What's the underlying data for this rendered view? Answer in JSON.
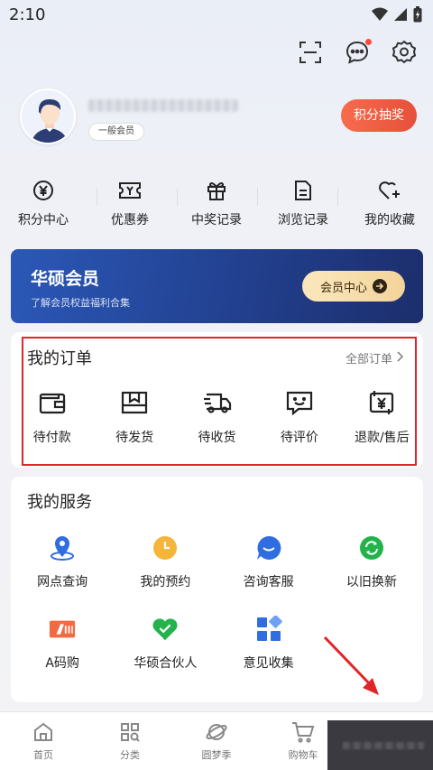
{
  "status_bar": {
    "time": "2:10"
  },
  "top_bar": {
    "icons": [
      "scan-icon",
      "message-icon",
      "settings-icon"
    ],
    "has_notification": true
  },
  "profile": {
    "member_level": "一般会员",
    "points_draw_label": "积分抽奖"
  },
  "quick_links": [
    {
      "label": "积分中心",
      "icon": "yen-coin-icon"
    },
    {
      "label": "优惠券",
      "icon": "coupon-icon"
    },
    {
      "label": "中奖记录",
      "icon": "gift-icon"
    },
    {
      "label": "浏览记录",
      "icon": "document-icon"
    },
    {
      "label": "我的收藏",
      "icon": "heart-plus-icon"
    }
  ],
  "vip_banner": {
    "title": "华硕会员",
    "subtitle": "了解会员权益福利合集",
    "button_label": "会员中心"
  },
  "orders": {
    "title": "我的订单",
    "all_label": "全部订单",
    "items": [
      {
        "label": "待付款",
        "icon": "wallet-icon"
      },
      {
        "label": "待发货",
        "icon": "package-icon"
      },
      {
        "label": "待收货",
        "icon": "truck-icon"
      },
      {
        "label": "待评价",
        "icon": "comment-smile-icon"
      },
      {
        "label": "退款/售后",
        "icon": "refund-icon"
      }
    ]
  },
  "services": {
    "title": "我的服务",
    "items": [
      {
        "label": "网点查询",
        "icon": "location-pin-icon"
      },
      {
        "label": "我的预约",
        "icon": "clock-icon"
      },
      {
        "label": "咨询客服",
        "icon": "chat-bubble-icon"
      },
      {
        "label": "以旧换新",
        "icon": "recycle-icon"
      },
      {
        "label": "A码购",
        "icon": "a-code-icon"
      },
      {
        "label": "华硕合伙人",
        "icon": "partner-icon"
      },
      {
        "label": "意见收集",
        "icon": "grid-icon"
      }
    ]
  },
  "bottom_nav": [
    {
      "label": "首页",
      "icon": "home-icon"
    },
    {
      "label": "分类",
      "icon": "category-icon"
    },
    {
      "label": "圆梦季",
      "icon": "planet-icon"
    },
    {
      "label": "购物车",
      "icon": "cart-icon"
    }
  ],
  "colors": {
    "accent_red": "#e5503a",
    "vip_blue": "#22408f",
    "vip_gold": "#f3d49a",
    "highlight_outline": "#e0252b"
  }
}
